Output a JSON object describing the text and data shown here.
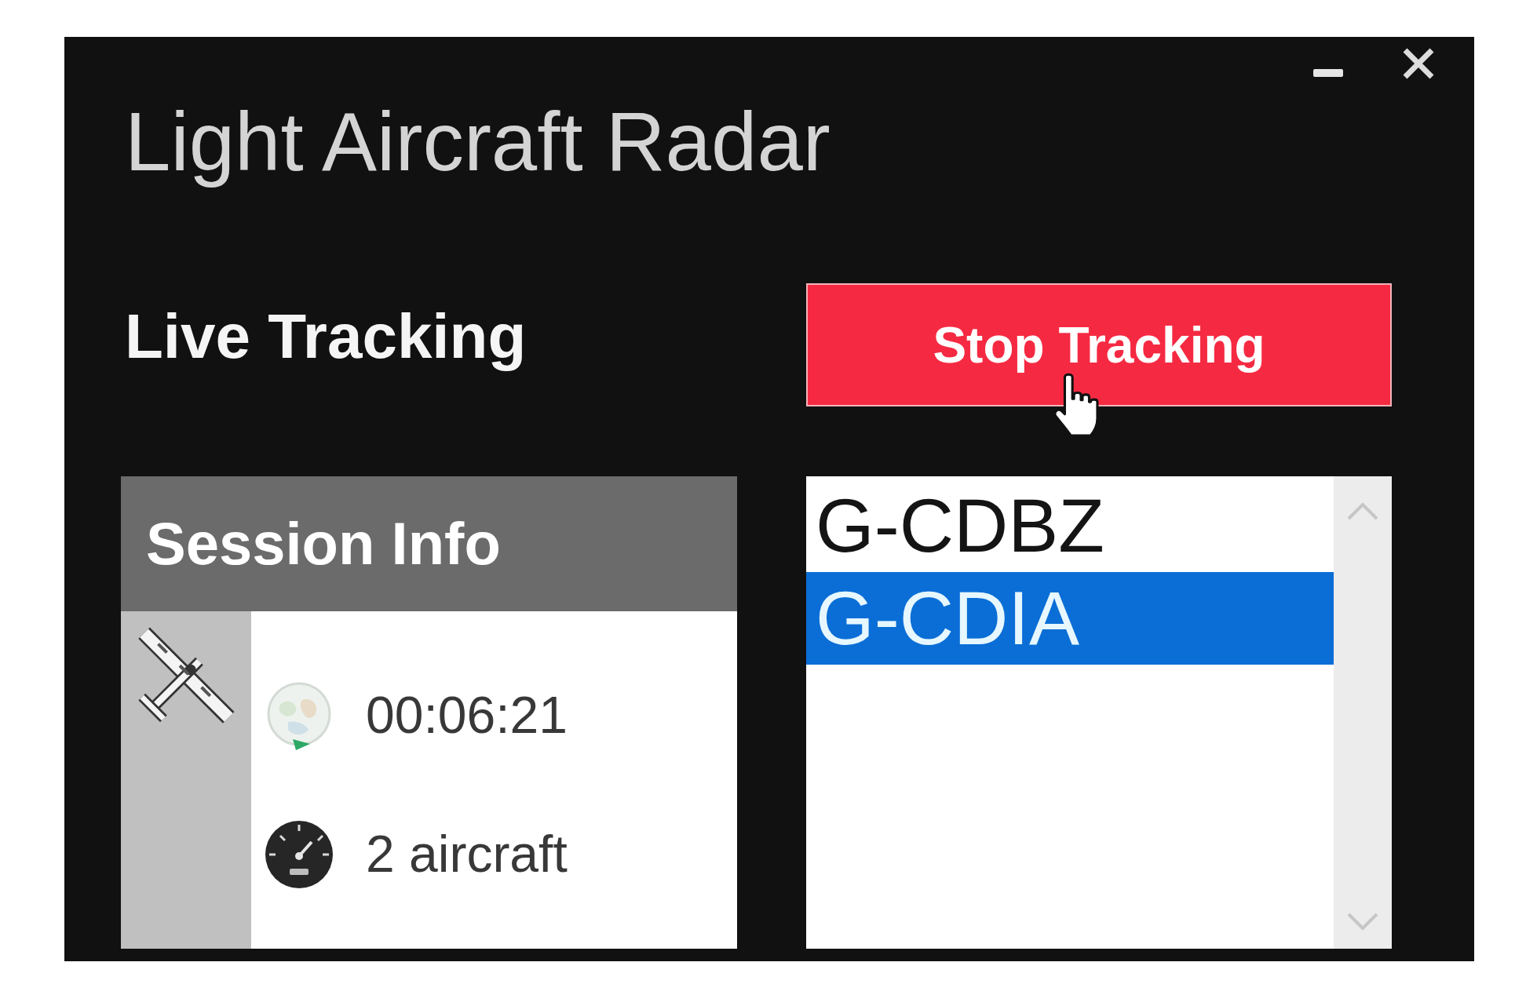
{
  "window": {
    "title": "Light Aircraft Radar"
  },
  "heading": "Live Tracking",
  "stop_button": {
    "label": "Stop Tracking"
  },
  "session_info": {
    "title": "Session Info",
    "rows": [
      {
        "kind": "elapsed",
        "value": "00:06:21"
      },
      {
        "kind": "count",
        "value": "2 aircraft"
      }
    ]
  },
  "aircraft_list": {
    "items": [
      {
        "label": "G-CDBZ",
        "selected": false
      },
      {
        "label": "G-CDIA",
        "selected": true
      }
    ]
  }
}
